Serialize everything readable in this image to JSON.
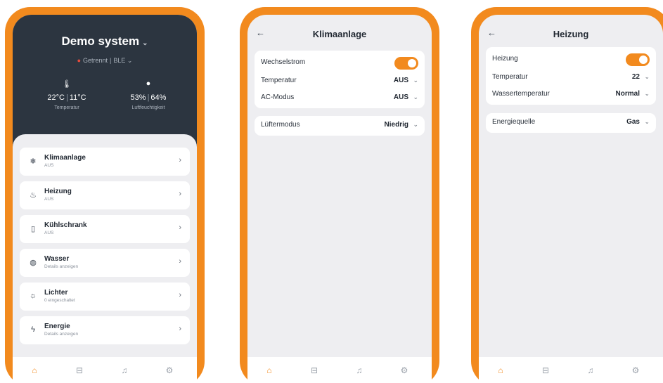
{
  "phone1": {
    "system_title": "Demo system",
    "status_text": "Getrennt",
    "connection": "BLE",
    "temperature": {
      "value_inside": "22°C",
      "value_outside": "11°C",
      "label": "Temperatur"
    },
    "humidity": {
      "value_inside": "53%",
      "value_outside": "64%",
      "label": "Luftfeuchtigkeit"
    },
    "devices": [
      {
        "name": "Klimaanlage",
        "status": "AUS",
        "icon": "ac-icon"
      },
      {
        "name": "Heizung",
        "status": "AUS",
        "icon": "heater-icon"
      },
      {
        "name": "Kühlschrank",
        "status": "AUS",
        "icon": "fridge-icon"
      },
      {
        "name": "Wasser",
        "status": "Details anzeigen",
        "icon": "water-icon"
      },
      {
        "name": "Lichter",
        "status": "0 eingeschaltet",
        "icon": "light-icon"
      },
      {
        "name": "Energie",
        "status": "Details anzeigen",
        "icon": "energy-icon"
      }
    ]
  },
  "phone2": {
    "title": "Klimaanlage",
    "power_label": "Wechselstrom",
    "power_on": true,
    "temperature_label": "Temperatur",
    "temperature_value": "AUS",
    "mode_label": "AC-Modus",
    "mode_value": "AUS",
    "fan_label": "Lüftermodus",
    "fan_value": "Niedrig"
  },
  "phone3": {
    "title": "Heizung",
    "power_label": "Heizung",
    "power_on": true,
    "temperature_label": "Temperatur",
    "temperature_value": "22",
    "water_temp_label": "Wassertemperatur",
    "water_temp_value": "Normal",
    "energy_label": "Energiequelle",
    "energy_value": "Gas"
  },
  "colors": {
    "accent": "#f28a1e",
    "header_dark": "#2c3540",
    "background": "#eeeef1",
    "status_red": "#e44b3c"
  },
  "nav_icons": [
    "home-icon",
    "vehicle-icon",
    "bell-icon",
    "settings-icon"
  ]
}
